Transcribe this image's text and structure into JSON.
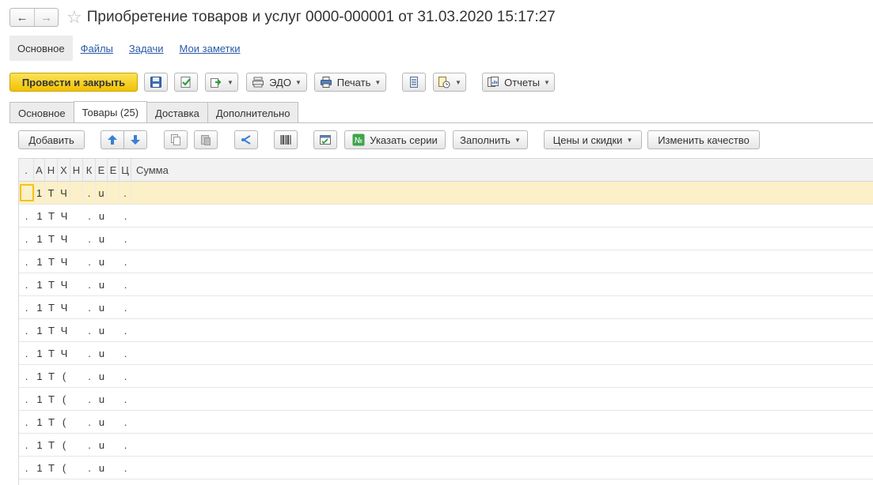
{
  "window": {
    "title": "Приобретение товаров и услуг 0000-000001 от 31.03.2020 15:17:27"
  },
  "nav": {
    "back_icon": "arrow-left-icon",
    "forward_icon": "arrow-right-icon",
    "favorite_icon": "star-icon"
  },
  "section_tabs": [
    {
      "label": "Основное",
      "active": true
    },
    {
      "label": "Файлы",
      "active": false
    },
    {
      "label": "Задачи",
      "active": false
    },
    {
      "label": "Мои заметки",
      "active": false
    }
  ],
  "main_toolbar": {
    "post_close_label": "Провести и закрыть",
    "edo_label": "ЭДО",
    "print_label": "Печать",
    "reports_label": "Отчеты"
  },
  "form_tabs": [
    {
      "label": "Основное",
      "active": false
    },
    {
      "label": "Товары (25)",
      "active": true
    },
    {
      "label": "Доставка",
      "active": false
    },
    {
      "label": "Дополнительно",
      "active": false
    }
  ],
  "goods_toolbar": {
    "add_label": "Добавить",
    "series_label": "Указать серии",
    "fill_label": "Заполнить",
    "prices_label": "Цены и скидки",
    "quality_label": "Изменить качество"
  },
  "table": {
    "columns": [
      ".",
      "А",
      "Н",
      "Х",
      "Н",
      "К",
      "Е",
      "Е",
      "Ц",
      "Сумма"
    ],
    "rows": [
      [
        ".",
        "1",
        "Т",
        "Ч",
        "",
        ".",
        "u",
        "",
        ".",
        ""
      ],
      [
        ".",
        "1",
        "Т",
        "Ч",
        "",
        ".",
        "u",
        "",
        ".",
        ""
      ],
      [
        ".",
        "1",
        "Т",
        "Ч",
        "",
        ".",
        "u",
        "",
        ".",
        ""
      ],
      [
        ".",
        "1",
        "Т",
        "Ч",
        "",
        ".",
        "u",
        "",
        ".",
        ""
      ],
      [
        ".",
        "1",
        "Т",
        "Ч",
        "",
        ".",
        "u",
        "",
        ".",
        ""
      ],
      [
        ".",
        "1",
        "Т",
        "Ч",
        "",
        ".",
        "u",
        "",
        ".",
        ""
      ],
      [
        ".",
        "1",
        "Т",
        "Ч",
        "",
        ".",
        "u",
        "",
        ".",
        ""
      ],
      [
        ".",
        "1",
        "Т",
        "Ч",
        "",
        ".",
        "u",
        "",
        ".",
        ""
      ],
      [
        ".",
        "1",
        "Т",
        "(",
        "",
        ".",
        "u",
        "",
        ".",
        ""
      ],
      [
        ".",
        "1",
        "Т",
        "(",
        "",
        ".",
        "u",
        "",
        ".",
        ""
      ],
      [
        ".",
        "1",
        "Т",
        "(",
        "",
        ".",
        "u",
        "",
        ".",
        ""
      ],
      [
        ".",
        "1",
        "Т",
        "(",
        "",
        ".",
        "u",
        "",
        ".",
        ""
      ],
      [
        ".",
        "1",
        "Т",
        "(",
        "",
        ".",
        "u",
        "",
        ".",
        ""
      ]
    ]
  },
  "colors": {
    "primary_button": "#f5cd1f",
    "selected_row": "#fbf0c7",
    "link": "#2a5aa8"
  }
}
